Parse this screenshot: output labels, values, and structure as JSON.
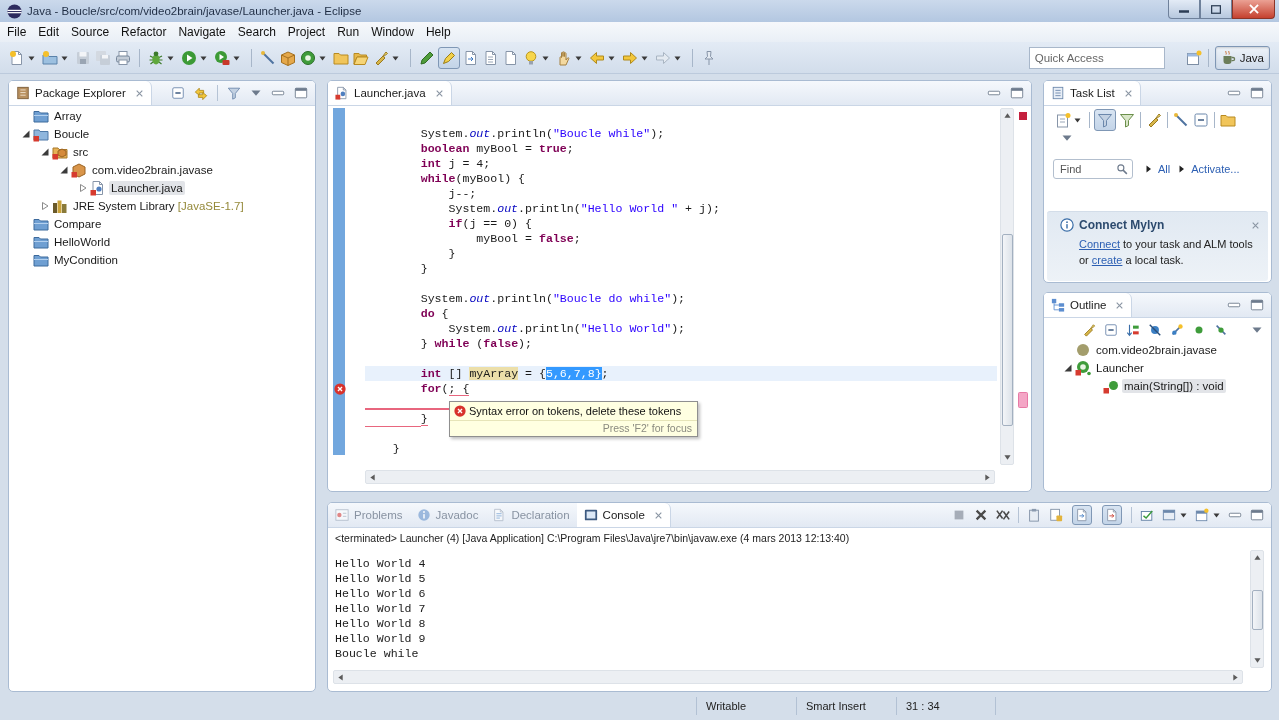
{
  "window": {
    "title": "Java - Boucle/src/com/video2brain/javase/Launcher.java - Eclipse"
  },
  "menu": [
    "File",
    "Edit",
    "Source",
    "Refactor",
    "Navigate",
    "Search",
    "Project",
    "Run",
    "Window",
    "Help"
  ],
  "toolbar": {
    "toggles": [
      {
        "on": true
      }
    ],
    "quick_access": {
      "placeholder": "Quick Access"
    },
    "perspectives": [
      {
        "label": "Java",
        "selected": true
      }
    ]
  },
  "package_explorer": {
    "tabs": [
      {
        "label": "Package Explorer",
        "selected": true
      }
    ],
    "tree": [
      {
        "label": "Array",
        "kind": "closed-project",
        "selected": false
      },
      {
        "label": "Boucle",
        "kind": "project",
        "expanded": true,
        "selected": false,
        "children": [
          {
            "label": "src",
            "kind": "source-folder",
            "expanded": true,
            "selected": false,
            "children": [
              {
                "label": "com.video2brain.javase",
                "kind": "package",
                "expanded": true,
                "selected": false,
                "children": [
                  {
                    "label": "Launcher.java",
                    "kind": "java-file",
                    "expanded": false,
                    "selected": true
                  }
                ]
              }
            ]
          },
          {
            "label": "JRE System Library",
            "decoration": "[JavaSE-1.7]",
            "kind": "library",
            "expanded": false,
            "selected": false
          }
        ]
      },
      {
        "label": "Compare",
        "kind": "closed-project",
        "selected": false
      },
      {
        "label": "HelloWorld",
        "kind": "closed-project",
        "selected": false
      },
      {
        "label": "MyCondition",
        "kind": "closed-project",
        "selected": false
      }
    ]
  },
  "editor": {
    "tabs": [
      {
        "label": "Launcher.java",
        "selected": true
      }
    ],
    "lines": [
      {
        "current": false,
        "error_marker": false,
        "segments": [
          {
            "kind": "plain",
            "text": "        System."
          },
          {
            "kind": "field",
            "text": "out"
          },
          {
            "kind": "plain",
            "text": ".println("
          },
          {
            "kind": "string",
            "text": "\"Boucle while\""
          },
          {
            "kind": "plain",
            "text": ");"
          }
        ]
      },
      {
        "current": false,
        "error_marker": false,
        "segments": [
          {
            "kind": "keyword",
            "text": "        boolean"
          },
          {
            "kind": "plain",
            "text": " myBool = "
          },
          {
            "kind": "keyword",
            "text": "true"
          },
          {
            "kind": "plain",
            "text": ";"
          }
        ]
      },
      {
        "current": false,
        "error_marker": false,
        "segments": [
          {
            "kind": "keyword",
            "text": "        int"
          },
          {
            "kind": "plain",
            "text": " j = 4;"
          }
        ]
      },
      {
        "current": false,
        "error_marker": false,
        "segments": [
          {
            "kind": "keyword",
            "text": "        while"
          },
          {
            "kind": "plain",
            "text": "(myBool) {"
          }
        ]
      },
      {
        "current": false,
        "error_marker": false,
        "segments": [
          {
            "kind": "plain",
            "text": "            j--;"
          }
        ]
      },
      {
        "current": false,
        "error_marker": false,
        "segments": [
          {
            "kind": "plain",
            "text": "            System."
          },
          {
            "kind": "field",
            "text": "out"
          },
          {
            "kind": "plain",
            "text": ".println("
          },
          {
            "kind": "string",
            "text": "\"Hello World \""
          },
          {
            "kind": "plain",
            "text": " + j);"
          }
        ]
      },
      {
        "current": false,
        "error_marker": false,
        "segments": [
          {
            "kind": "keyword",
            "text": "            if"
          },
          {
            "kind": "plain",
            "text": "(j == 0) {"
          }
        ]
      },
      {
        "current": false,
        "error_marker": false,
        "segments": [
          {
            "kind": "plain",
            "text": "                myBool = "
          },
          {
            "kind": "keyword",
            "text": "false"
          },
          {
            "kind": "plain",
            "text": ";"
          }
        ]
      },
      {
        "current": false,
        "error_marker": false,
        "segments": [
          {
            "kind": "plain",
            "text": "            }"
          }
        ]
      },
      {
        "current": false,
        "error_marker": false,
        "segments": [
          {
            "kind": "plain",
            "text": "        }"
          }
        ]
      },
      {
        "current": false,
        "error_marker": false
      },
      {
        "current": false,
        "error_marker": false,
        "segments": [
          {
            "kind": "plain",
            "text": "        System."
          },
          {
            "kind": "field",
            "text": "out"
          },
          {
            "kind": "plain",
            "text": ".println("
          },
          {
            "kind": "string",
            "text": "\"Boucle do while\""
          },
          {
            "kind": "plain",
            "text": ");"
          }
        ]
      },
      {
        "current": false,
        "error_marker": false,
        "segments": [
          {
            "kind": "keyword",
            "text": "        do"
          },
          {
            "kind": "plain",
            "text": " {"
          }
        ]
      },
      {
        "current": false,
        "error_marker": false,
        "segments": [
          {
            "kind": "plain",
            "text": "            System."
          },
          {
            "kind": "field",
            "text": "out"
          },
          {
            "kind": "plain",
            "text": ".println("
          },
          {
            "kind": "string",
            "text": "\"Hello World\""
          },
          {
            "kind": "plain",
            "text": ");"
          }
        ]
      },
      {
        "current": false,
        "error_marker": false,
        "segments": [
          {
            "kind": "plain",
            "text": "        } "
          },
          {
            "kind": "keyword",
            "text": "while"
          },
          {
            "kind": "plain",
            "text": " ("
          },
          {
            "kind": "keyword",
            "text": "false"
          },
          {
            "kind": "plain",
            "text": ");"
          }
        ]
      },
      {
        "current": false,
        "error_marker": false
      },
      {
        "current": true,
        "error_marker": false,
        "segments": [
          {
            "kind": "keyword",
            "text": "        int"
          },
          {
            "kind": "plain",
            "text": " [] "
          },
          {
            "kind": "occurrence",
            "text": "myArray"
          },
          {
            "kind": "plain",
            "text": " = {"
          },
          {
            "kind": "selection",
            "text": "5,6,7,8}"
          },
          {
            "kind": "plain",
            "text": ";"
          }
        ]
      },
      {
        "current": false,
        "error_marker": true,
        "segments": [
          {
            "kind": "keyword",
            "text": "        for"
          },
          {
            "kind": "plain",
            "text": "("
          },
          {
            "kind": "squiggle",
            "text": "; {"
          }
        ]
      },
      {
        "current": false,
        "error_marker": false,
        "segments": [
          {
            "kind": "error-underline"
          }
        ]
      },
      {
        "current": false,
        "error_marker": false,
        "segments": [
          {
            "kind": "squiggle",
            "text": "        }"
          }
        ]
      },
      {
        "current": false,
        "error_marker": false
      },
      {
        "current": false,
        "error_marker": false,
        "segments": [
          {
            "kind": "plain",
            "text": "    }"
          }
        ]
      }
    ],
    "tooltip": {
      "message": "Syntax error on tokens, delete these tokens",
      "hint": "Press 'F2' for focus"
    }
  },
  "task_list": {
    "tabs": [
      {
        "label": "Task List",
        "selected": true
      }
    ],
    "toggles": [
      {
        "on": true
      }
    ],
    "find": {
      "placeholder": "Find"
    },
    "filters": [
      "All",
      "Activate..."
    ],
    "mylyn": {
      "title": "Connect Mylyn",
      "message": [
        {
          "kind": "link",
          "text": "Connect"
        },
        {
          "kind": "text",
          "text": " to your task and ALM tools or "
        },
        {
          "kind": "link",
          "text": "create"
        },
        {
          "kind": "text",
          "text": " a local task."
        }
      ]
    }
  },
  "outline": {
    "tabs": [
      {
        "label": "Outline",
        "selected": true
      }
    ],
    "tree": [
      {
        "label": "com.video2brain.javase",
        "kind": "package",
        "selected": false
      },
      {
        "label": "Launcher",
        "kind": "class",
        "expanded": true,
        "selected": false,
        "children": [
          {
            "label": "main(String[]) : void",
            "kind": "method",
            "selected": true
          }
        ]
      }
    ]
  },
  "console_view": {
    "tabs": [
      {
        "kind": "problems",
        "label": "Problems",
        "selected": false
      },
      {
        "kind": "javadoc",
        "label": "Javadoc",
        "selected": false
      },
      {
        "kind": "declaration",
        "label": "Declaration",
        "selected": false
      },
      {
        "kind": "console",
        "label": "Console",
        "selected": true
      }
    ],
    "toggles": [
      {
        "on": true
      },
      {
        "on": true
      }
    ],
    "process": "<terminated> Launcher (4) [Java Application] C:\\Program Files\\Java\\jre7\\bin\\javaw.exe (4 mars 2013 12:13:40)",
    "lines": [
      "Hello World 4",
      "Hello World 5",
      "Hello World 6",
      "Hello World 7",
      "Hello World 8",
      "Hello World 9",
      "Boucle while"
    ]
  },
  "status_bar": [
    "Writable",
    "Smart Insert",
    "31 : 34"
  ]
}
